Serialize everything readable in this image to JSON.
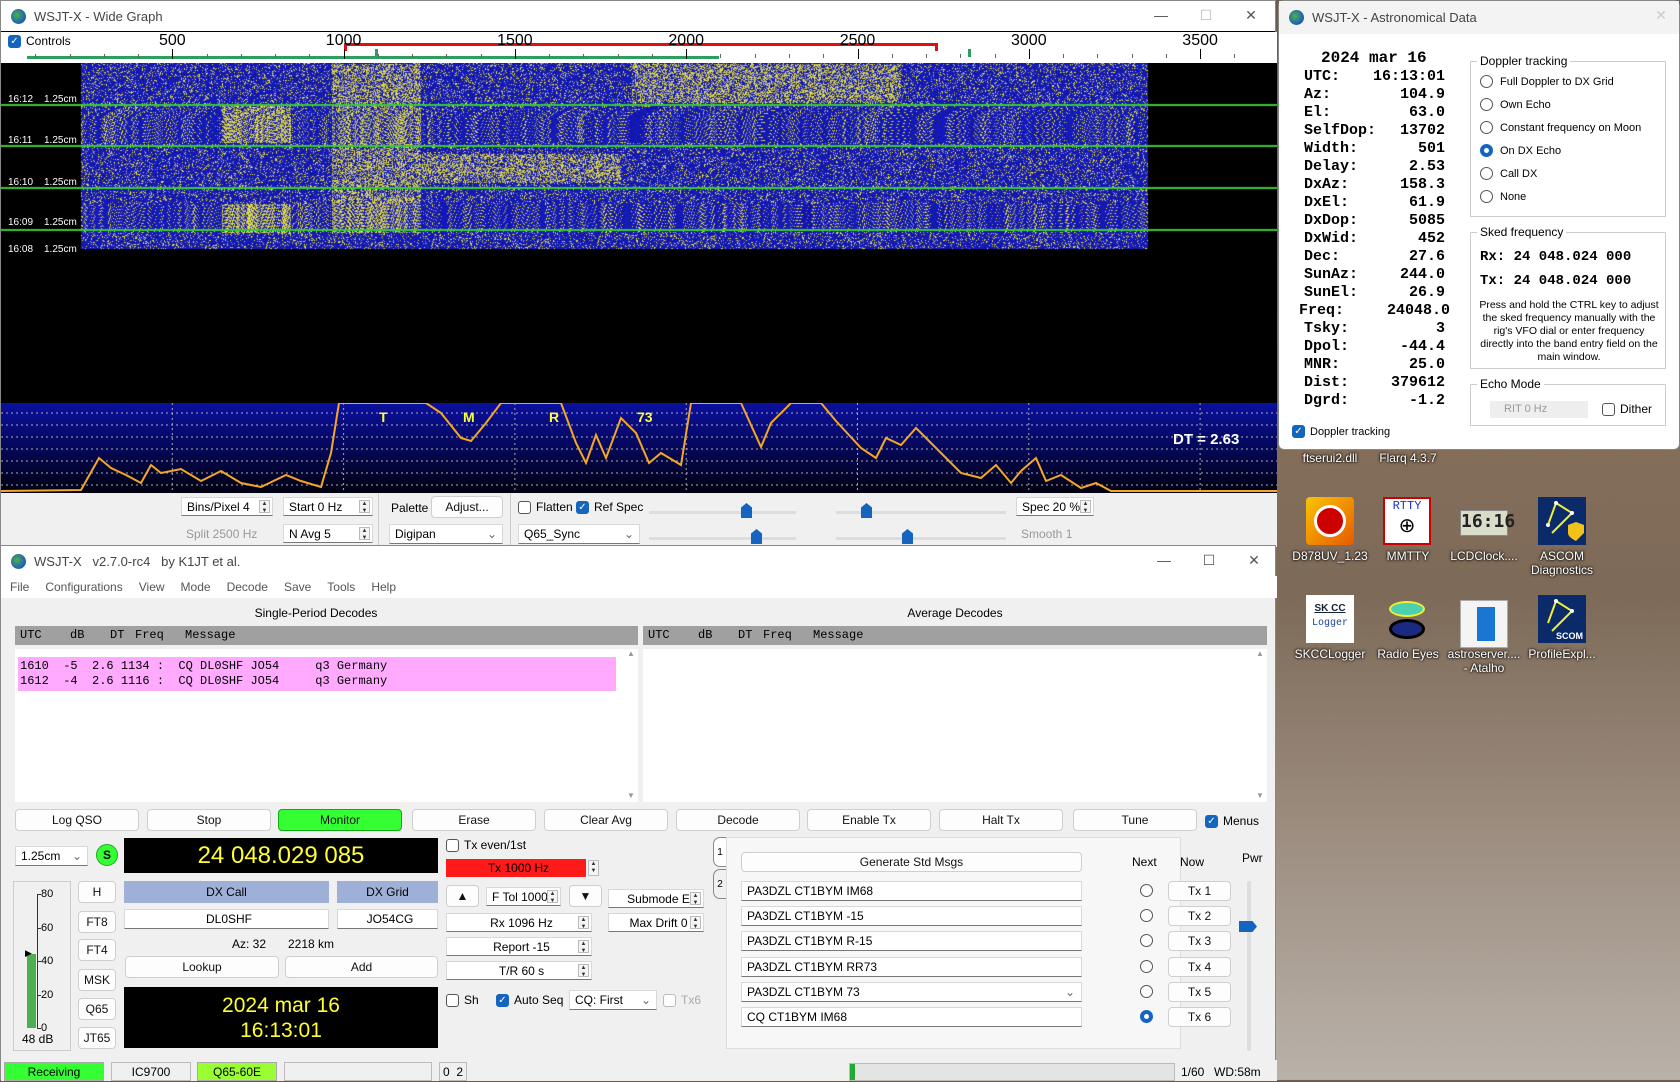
{
  "wide_graph": {
    "title": "WSJT-X - Wide Graph",
    "controls_label": "Controls",
    "controls_checked": true,
    "freq_ticks": [
      "500",
      "1000",
      "1500",
      "2000",
      "2500",
      "3000",
      "3500"
    ],
    "time_labels": [
      {
        "time": "16:12",
        "band": "1.25cm"
      },
      {
        "time": "16:11",
        "band": "1.25cm"
      },
      {
        "time": "16:10",
        "band": "1.25cm"
      },
      {
        "time": "16:09",
        "band": "1.25cm"
      },
      {
        "time": "16:08",
        "band": "1.25cm"
      }
    ],
    "spectrum_markers": [
      "T",
      "M",
      "R",
      "73"
    ],
    "dt_readout": "DT = 2.63",
    "bins_pixel": "Bins/Pixel  4",
    "start": "Start 0 Hz",
    "split": "Split  2500  Hz",
    "n_avg": "N Avg 5",
    "palette_label": "Palette",
    "adjust_button": "Adjust...",
    "palette_value": "Digipan",
    "flatten_label": "Flatten",
    "flatten_checked": false,
    "ref_spec_label": "Ref Spec",
    "ref_spec_checked": true,
    "spectrum_type": "Q65_Sync",
    "spec_pct": "Spec 20 %",
    "smooth": "Smooth  1",
    "colors": {
      "waterfall_bg": "#0a10a0",
      "signal": "#e8e040",
      "spectrum_line": "#f5a623",
      "rx_marker": "#e01010",
      "tx_marker": "#2e9e5e"
    }
  },
  "main": {
    "title": "WSJT-X   v2.7.0-rc4   by K1JT et al.",
    "menu": [
      "File",
      "Configurations",
      "View",
      "Mode",
      "Decode",
      "Save",
      "Tools",
      "Help"
    ],
    "single_title": "Single-Period Decodes",
    "average_title": "Average Decodes",
    "columns": [
      "UTC",
      "dB",
      "DT",
      "Freq",
      "Message"
    ],
    "decodes": [
      "1610  -5  2.6 1134 :  CQ DL0SHF JO54     q3 Germany",
      "1612  -4  2.6 1116 :  CQ DL0SHF JO54     q3 Germany"
    ],
    "buttons": [
      "Log QSO",
      "Stop",
      "Monitor",
      "Erase",
      "Clear Avg",
      "Decode",
      "Enable Tx",
      "Halt Tx",
      "Tune"
    ],
    "menus_label": "Menus",
    "menus_checked": true,
    "band": "1.25cm",
    "s_label": "S",
    "dial_freq": "24 048.029 085",
    "dx_call_label": "DX Call",
    "dx_grid_label": "DX Grid",
    "dx_call": "DL0SHF",
    "dx_grid": "JO54CG",
    "az": "Az: 32",
    "dist": "2218 km",
    "lookup": "Lookup",
    "add": "Add",
    "date": "2024 mar 16",
    "time": "16:13:01",
    "meter_ticks": [
      "80",
      "60",
      "40",
      "20",
      "0"
    ],
    "meter_level_db": 48,
    "meter_readout": "48 dB",
    "modes": [
      "H",
      "FT8",
      "FT4",
      "MSK",
      "Q65",
      "JT65"
    ],
    "tx_even": "Tx even/1st",
    "tx_freq": "Tx  1000  Hz",
    "ftol": "F Tol  1000",
    "submode": "Submode E",
    "rx_freq": "Rx  1096  Hz",
    "max_drift": "Max Drift  0",
    "report": "Report -15",
    "tr": "T/R  60  s",
    "sh": "Sh",
    "auto_seq": "Auto Seq",
    "auto_seq_checked": true,
    "cq_select": "CQ: First",
    "tx6": "Tx6",
    "tabs": [
      "1",
      "2"
    ],
    "gen_std": "Generate Std Msgs",
    "next_label": "Next",
    "now_label": "Now",
    "messages": [
      "PA3DZL CT1BYM IM68",
      "PA3DZL CT1BYM -15",
      "PA3DZL CT1BYM R-15",
      "PA3DZL CT1BYM RR73",
      "PA3DZL CT1BYM 73",
      "CQ CT1BYM IM68"
    ],
    "tx_buttons": [
      "Tx 1",
      "Tx 2",
      "Tx 3",
      "Tx 4",
      "Tx 5",
      "Tx 6"
    ],
    "next_selected": 6,
    "pwr_label": "Pwr",
    "status": {
      "state": "Receiving",
      "rig": "IC9700",
      "mode": "Q65-60E",
      "blank": "",
      "count": "0  2",
      "period": "1/60",
      "wd": "WD:58m"
    },
    "colors": {
      "monitor": "#33ff33",
      "tx_red": "#ff1a1a",
      "dx_label": "#9fb0d8",
      "display_text": "#ffff33",
      "decode_row": "#ffaaff",
      "receiving": "#33ff33",
      "mode_bg": "#99ff33"
    }
  },
  "astro": {
    "title": "WSJT-X - Astronomical Data",
    "date": "2024 mar 16",
    "rows": [
      [
        "UTC:",
        "16:13:01"
      ],
      [
        "Az:",
        "104.9"
      ],
      [
        "El:",
        "63.0"
      ],
      [
        "SelfDop:",
        "13702"
      ],
      [
        "Width:",
        "501"
      ],
      [
        "Delay:",
        "2.53"
      ],
      [
        "DxAz:",
        "158.3"
      ],
      [
        "DxEl:",
        "61.9"
      ],
      [
        "DxDop:",
        "5085"
      ],
      [
        "DxWid:",
        "452"
      ],
      [
        "Dec:",
        "27.6"
      ],
      [
        "SunAz:",
        "244.0"
      ],
      [
        "SunEl:",
        "26.9"
      ],
      [
        "Freq:",
        "24048.0"
      ],
      [
        "Tsky:",
        "3"
      ],
      [
        "Dpol:",
        "-44.4"
      ],
      [
        "MNR:",
        "25.0"
      ],
      [
        "Dist:",
        "379612"
      ],
      [
        "Dgrd:",
        "-1.2"
      ]
    ],
    "doppler_title": "Doppler tracking",
    "doppler_options": [
      "Full Doppler to DX Grid",
      "Own Echo",
      "Constant frequency on Moon",
      "On DX Echo",
      "Call DX",
      "None"
    ],
    "doppler_selected": "On DX Echo",
    "sked_title": "Sked frequency",
    "sked_rx": "Rx: 24 048.024 000",
    "sked_tx": "Tx: 24 048.024 000",
    "sked_note": "Press and hold the CTRL key to adjust the sked frequency manually with the rig's VFO dial or enter frequency directly into the band entry field on the main window.",
    "echo_title": "Echo Mode",
    "rit": "RIT  0  Hz",
    "dither": "Dither",
    "doppler_tracking_label": "Doppler tracking",
    "doppler_tracking_checked": true
  },
  "desktop": {
    "top_labels": [
      "ftserui2.dll",
      "Flarq 4.3.7"
    ],
    "icons": [
      "D878UV_1.23",
      "MMTTY",
      "LCDClock....",
      "ASCOM Diagnostics",
      "SKCCLogger",
      "Radio Eyes",
      "astroserver.... - Atalho",
      "ProfileExpl..."
    ],
    "lcd_text": "16:16",
    "rtty_text": "RTTY",
    "skcc_text": "SK CC",
    "logger_text": "Logger",
    "scom_text": "SCOM"
  }
}
